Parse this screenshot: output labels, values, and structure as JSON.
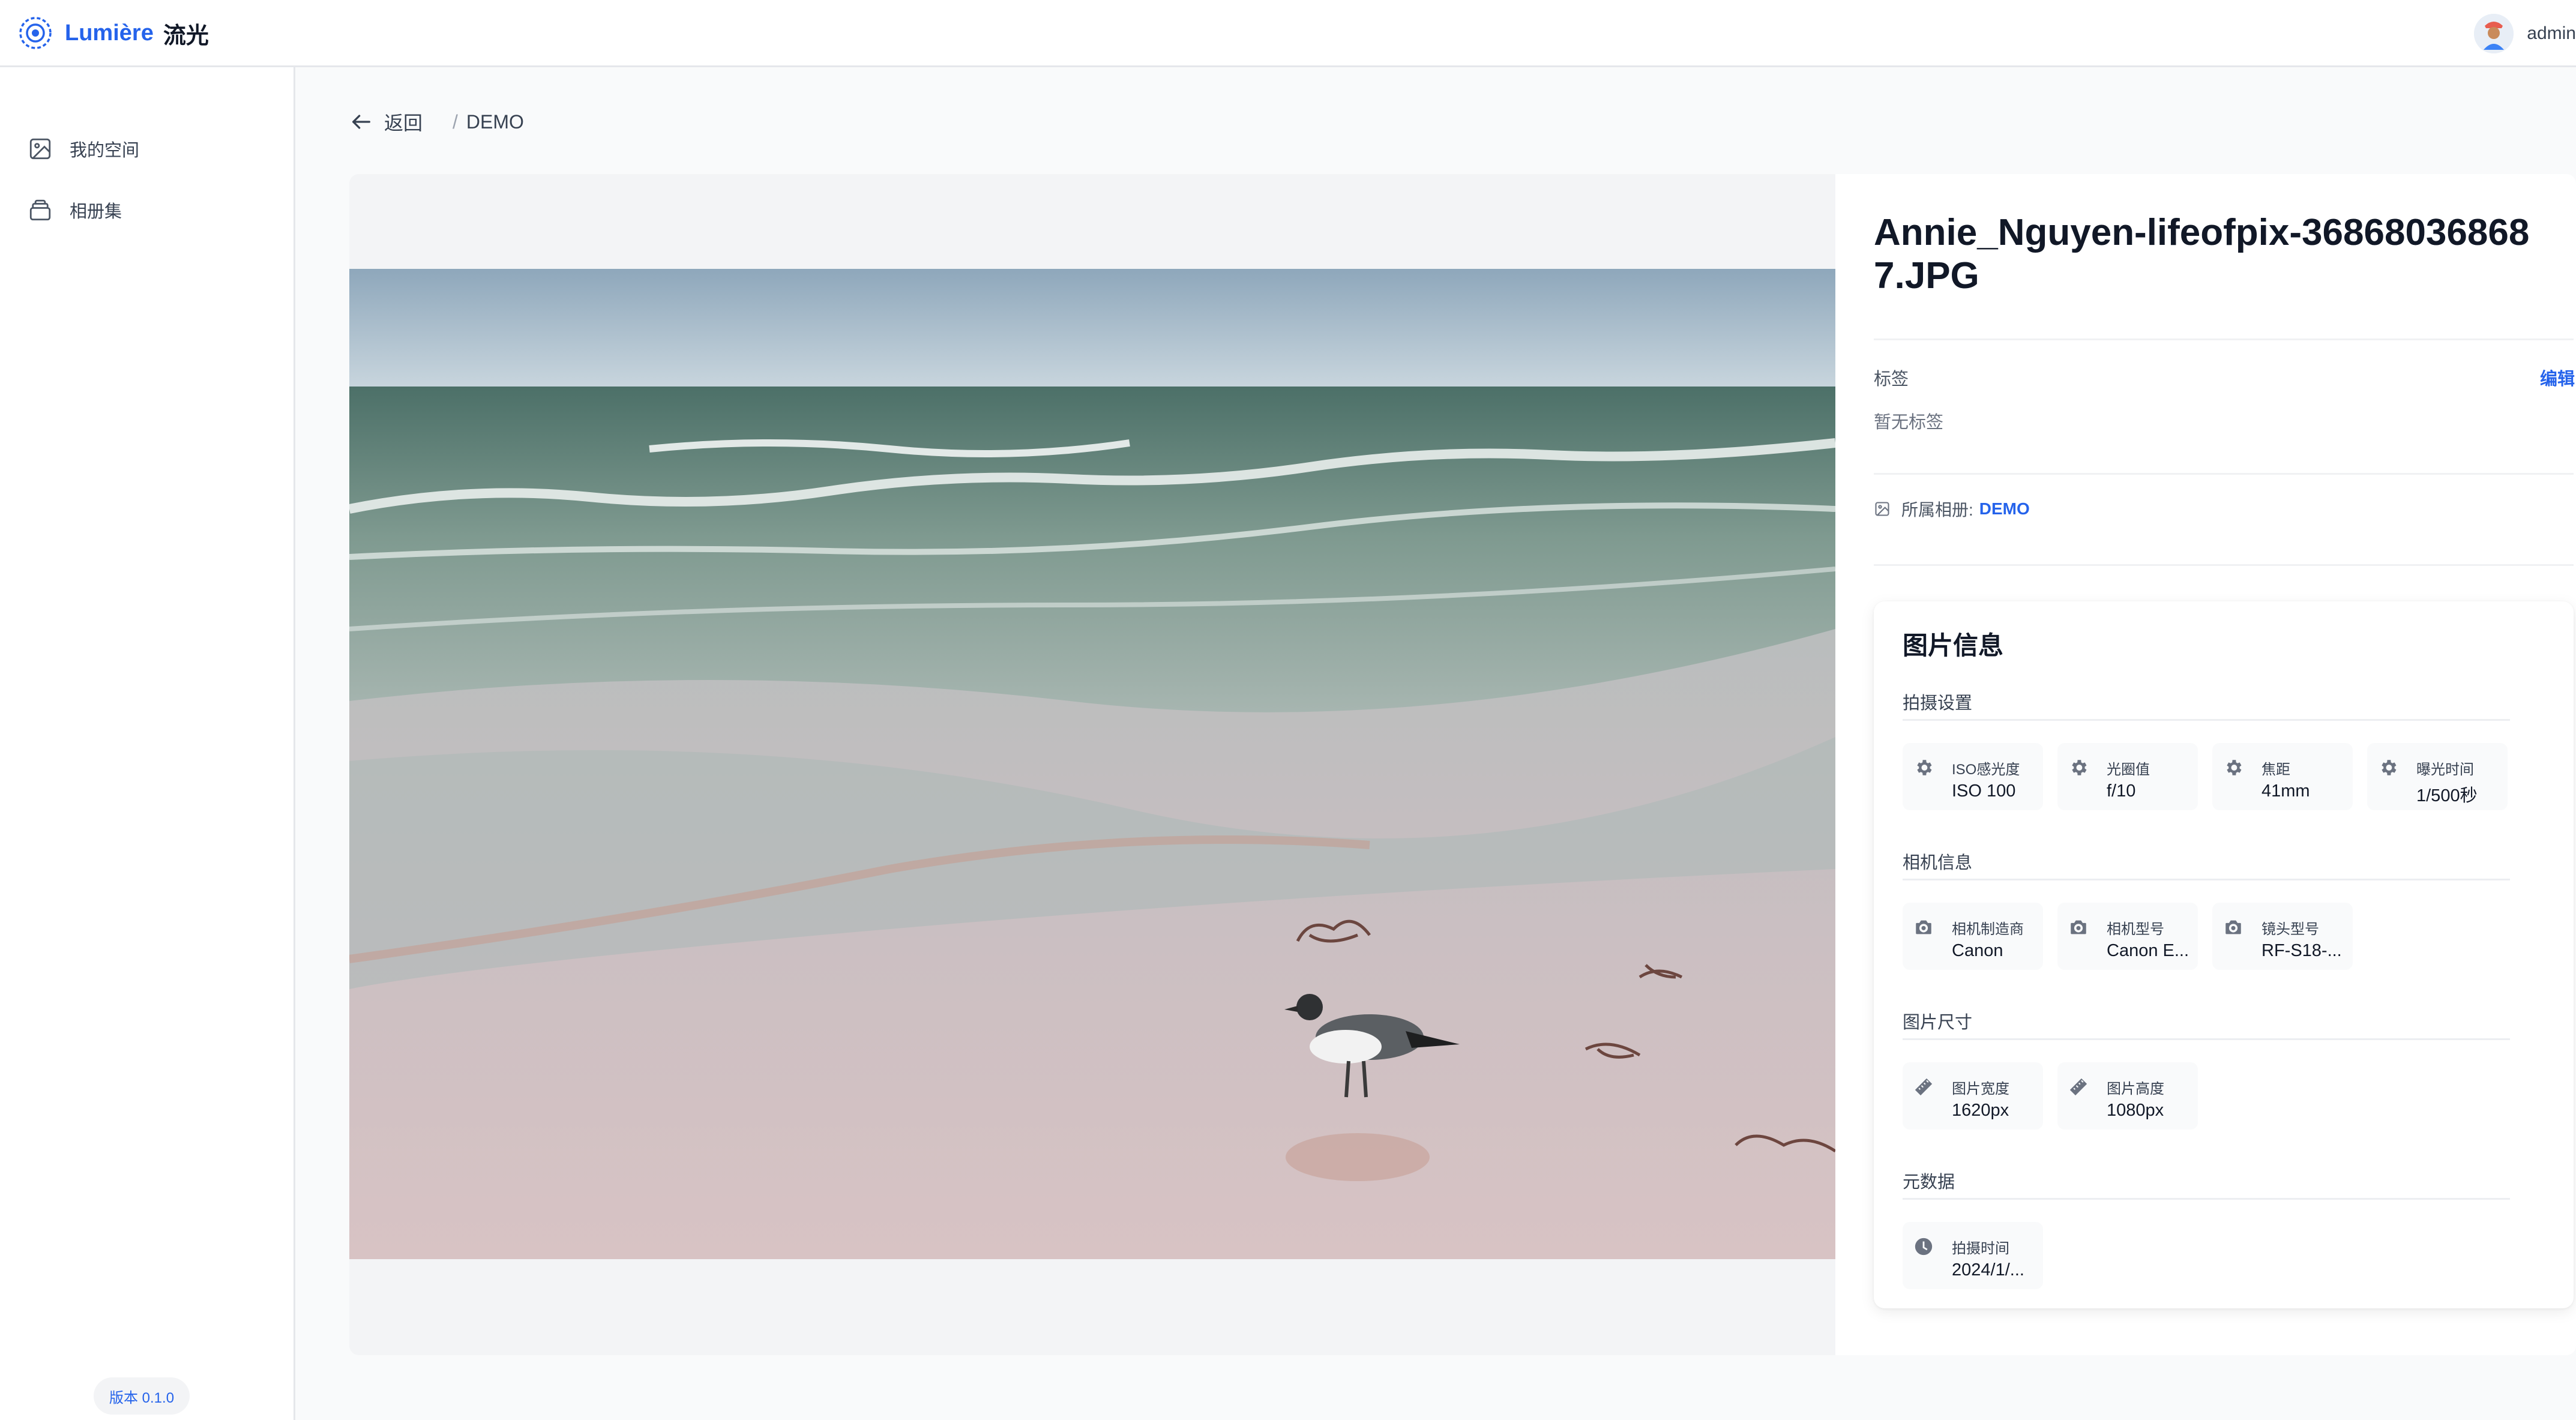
{
  "header": {
    "logo_en": "Lumière",
    "logo_cn": "流光",
    "username": "admin"
  },
  "sidebar": {
    "items": [
      {
        "label": "我的空间",
        "icon": "image-icon"
      },
      {
        "label": "相册集",
        "icon": "album-stack-icon"
      }
    ],
    "version": "版本 0.1.0"
  },
  "breadcrumb": {
    "back_label": "返回",
    "separator": "/",
    "current": "DEMO"
  },
  "photo": {
    "file_name": "Annie_Nguyen-lifeofpix-368680368687.JPG",
    "tags_label": "标签",
    "edit_label": "编辑",
    "tags_empty": "暂无标签",
    "album_label": "所属相册:",
    "album_name": "DEMO"
  },
  "meta": {
    "title": "图片信息",
    "sections": [
      {
        "title": "拍摄设置",
        "icon": "gear-icon",
        "items": [
          {
            "label": "ISO感光度",
            "value": "ISO 100"
          },
          {
            "label": "光圈值",
            "value": "f/10"
          },
          {
            "label": "焦距",
            "value": "41mm"
          },
          {
            "label": "曝光时间",
            "value": "1/500秒"
          }
        ]
      },
      {
        "title": "相机信息",
        "icon": "camera-icon",
        "items": [
          {
            "label": "相机制造商",
            "value": "Canon"
          },
          {
            "label": "相机型号",
            "value": "Canon E..."
          },
          {
            "label": "镜头型号",
            "value": "RF-S18-..."
          }
        ]
      },
      {
        "title": "图片尺寸",
        "icon": "ruler-icon",
        "items": [
          {
            "label": "图片宽度",
            "value": "1620px"
          },
          {
            "label": "图片高度",
            "value": "1080px"
          }
        ]
      },
      {
        "title": "元数据",
        "icon": "clock-icon",
        "items": [
          {
            "label": "拍摄时间",
            "value": "2024/1/..."
          }
        ]
      }
    ]
  },
  "colors": {
    "accent": "#2563eb",
    "text": "#111827",
    "muted": "#6b7280",
    "border": "#e5e7eb"
  }
}
